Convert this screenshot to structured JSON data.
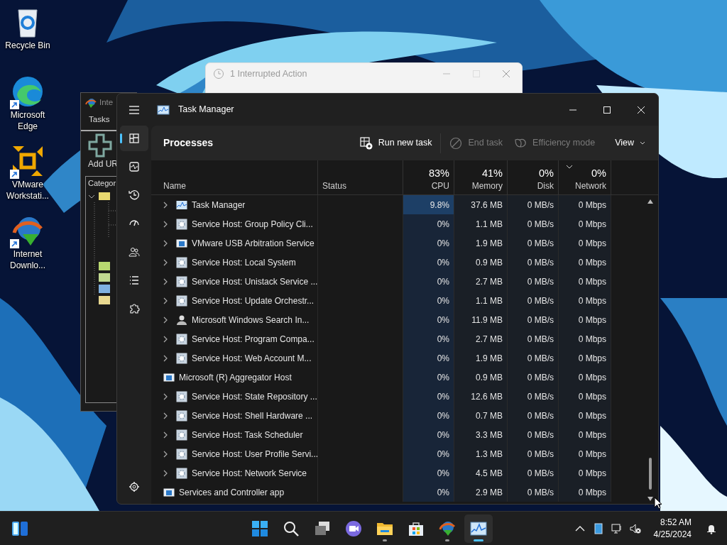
{
  "desktop_icons": [
    {
      "label": "Recycle Bin",
      "kind": "recycle",
      "shortcut": false
    },
    {
      "label": "Microsoft Edge",
      "kind": "edge",
      "shortcut": true
    },
    {
      "label": "VMware Workstati...",
      "kind": "vmware",
      "shortcut": true
    },
    {
      "label": "Internet Downlo...",
      "kind": "idm",
      "shortcut": true
    }
  ],
  "background_window": {
    "title": "1 Interrupted Action"
  },
  "idm_window": {
    "title": "Inte",
    "menu": "Tasks",
    "toolbar_button": "Add UR",
    "tree_header": "Categor"
  },
  "task_manager": {
    "title": "Task Manager",
    "nav": [
      {
        "kind": "processes",
        "selected": true
      },
      {
        "kind": "performance",
        "selected": false
      },
      {
        "kind": "history",
        "selected": false
      },
      {
        "kind": "startup",
        "selected": false
      },
      {
        "kind": "users",
        "selected": false
      },
      {
        "kind": "details",
        "selected": false
      },
      {
        "kind": "services",
        "selected": false
      },
      {
        "kind": "settings",
        "selected": false
      }
    ],
    "page_title": "Processes",
    "toolbar": [
      {
        "label": "Run new task",
        "kind": "run",
        "disabled": false
      },
      {
        "label": "End task",
        "kind": "end",
        "disabled": true
      },
      {
        "label": "Efficiency mode",
        "kind": "leaf",
        "disabled": true
      },
      {
        "label": "View",
        "kind": "view",
        "disabled": false
      }
    ],
    "columns": [
      {
        "label": "Name",
        "sorted": false
      },
      {
        "label": "Status",
        "sorted": false
      },
      {
        "label": "CPU",
        "total": "83%",
        "sorted": false
      },
      {
        "label": "Memory",
        "total": "41%",
        "sorted": false
      },
      {
        "label": "Disk",
        "total": "0%",
        "sorted": false
      },
      {
        "label": "Network",
        "total": "0%",
        "sorted": true
      }
    ],
    "rows": [
      {
        "name": "Task Manager",
        "kind": "taskmgr",
        "expandable": true,
        "hot": true,
        "cpu": "9.8%",
        "memory": "37.6 MB",
        "disk": "0 MB/s",
        "network": "0 Mbps"
      },
      {
        "name": "Service Host: Group Policy Cli...",
        "kind": "service",
        "expandable": true,
        "hot": false,
        "cpu": "0%",
        "memory": "1.1 MB",
        "disk": "0 MB/s",
        "network": "0 Mbps"
      },
      {
        "name": "VMware USB Arbitration Service",
        "kind": "app",
        "expandable": true,
        "hot": false,
        "cpu": "0%",
        "memory": "1.9 MB",
        "disk": "0 MB/s",
        "network": "0 Mbps"
      },
      {
        "name": "Service Host: Local System",
        "kind": "service",
        "expandable": true,
        "hot": false,
        "cpu": "0%",
        "memory": "0.9 MB",
        "disk": "0 MB/s",
        "network": "0 Mbps"
      },
      {
        "name": "Service Host: Unistack Service ...",
        "kind": "service",
        "expandable": true,
        "hot": false,
        "cpu": "0%",
        "memory": "2.7 MB",
        "disk": "0 MB/s",
        "network": "0 Mbps"
      },
      {
        "name": "Service Host: Update Orchestr...",
        "kind": "service",
        "expandable": true,
        "hot": false,
        "cpu": "0%",
        "memory": "1.1 MB",
        "disk": "0 MB/s",
        "network": "0 Mbps"
      },
      {
        "name": "Microsoft Windows Search In...",
        "kind": "search",
        "expandable": true,
        "hot": false,
        "cpu": "0%",
        "memory": "11.9 MB",
        "disk": "0 MB/s",
        "network": "0 Mbps"
      },
      {
        "name": "Service Host: Program Compa...",
        "kind": "service",
        "expandable": true,
        "hot": false,
        "cpu": "0%",
        "memory": "2.7 MB",
        "disk": "0 MB/s",
        "network": "0 Mbps"
      },
      {
        "name": "Service Host: Web Account M...",
        "kind": "service",
        "expandable": true,
        "hot": false,
        "cpu": "0%",
        "memory": "1.9 MB",
        "disk": "0 MB/s",
        "network": "0 Mbps"
      },
      {
        "name": "Microsoft (R) Aggregator Host",
        "kind": "app",
        "expandable": false,
        "hot": false,
        "cpu": "0%",
        "memory": "0.9 MB",
        "disk": "0 MB/s",
        "network": "0 Mbps"
      },
      {
        "name": "Service Host: State Repository ...",
        "kind": "service",
        "expandable": true,
        "hot": false,
        "cpu": "0%",
        "memory": "12.6 MB",
        "disk": "0 MB/s",
        "network": "0 Mbps"
      },
      {
        "name": "Service Host: Shell Hardware ...",
        "kind": "service",
        "expandable": true,
        "hot": false,
        "cpu": "0%",
        "memory": "0.7 MB",
        "disk": "0 MB/s",
        "network": "0 Mbps"
      },
      {
        "name": "Service Host: Task Scheduler",
        "kind": "service",
        "expandable": true,
        "hot": false,
        "cpu": "0%",
        "memory": "3.3 MB",
        "disk": "0 MB/s",
        "network": "0 Mbps"
      },
      {
        "name": "Service Host: User Profile Servi...",
        "kind": "service",
        "expandable": true,
        "hot": false,
        "cpu": "0%",
        "memory": "1.3 MB",
        "disk": "0 MB/s",
        "network": "0 Mbps"
      },
      {
        "name": "Service Host: Network Service",
        "kind": "service",
        "expandable": true,
        "hot": false,
        "cpu": "0%",
        "memory": "4.5 MB",
        "disk": "0 MB/s",
        "network": "0 Mbps"
      },
      {
        "name": "Services and Controller app",
        "kind": "app",
        "expandable": false,
        "hot": false,
        "cpu": "0%",
        "memory": "2.9 MB",
        "disk": "0 MB/s",
        "network": "0 Mbps"
      }
    ]
  },
  "taskbar": {
    "apps": [
      {
        "kind": "start",
        "running": false,
        "selected": false
      },
      {
        "kind": "search",
        "running": false,
        "selected": false
      },
      {
        "kind": "taskview",
        "running": false,
        "selected": false
      },
      {
        "kind": "chat",
        "running": false,
        "selected": false
      },
      {
        "kind": "explorer",
        "running": true,
        "selected": false
      },
      {
        "kind": "store",
        "running": false,
        "selected": false
      },
      {
        "kind": "idm",
        "running": true,
        "selected": false
      },
      {
        "kind": "taskmgr",
        "running": true,
        "selected": true
      }
    ],
    "time": "8:52 AM",
    "date": "4/25/2024"
  }
}
